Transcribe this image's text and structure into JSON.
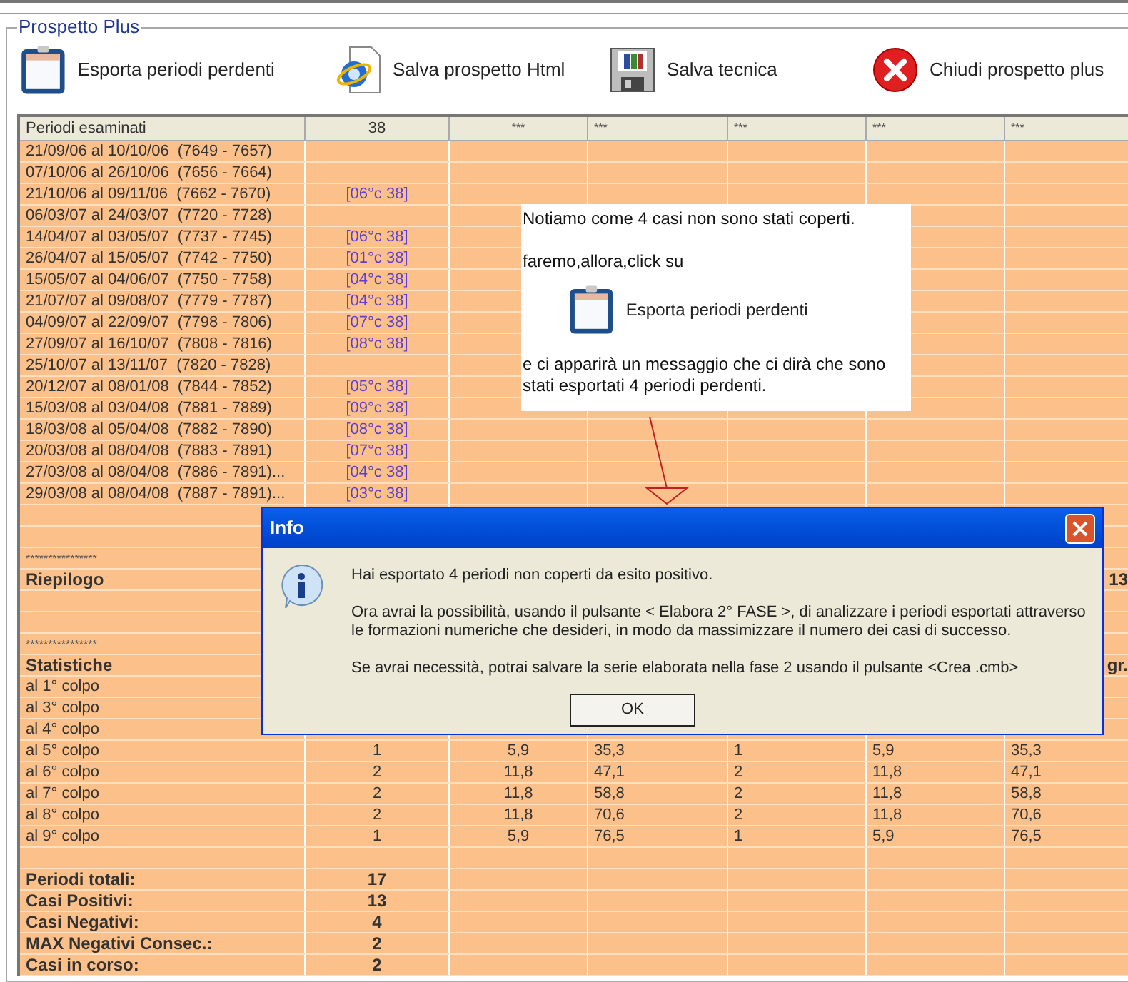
{
  "group_title": "Prospetto Plus",
  "toolbar": [
    {
      "kind": "clipboard",
      "label": "Esporta periodi perdenti"
    },
    {
      "kind": "globe",
      "label": "Salva prospetto Html"
    },
    {
      "kind": "disk",
      "label": "Salva tecnica"
    },
    {
      "kind": "close",
      "label": "Chiudi prospetto plus"
    }
  ],
  "table": {
    "columns": [
      "Periodi esaminati",
      "38",
      "***",
      "***",
      "***",
      "***",
      "***"
    ],
    "rows": [
      {
        "kind": "period",
        "label": "21/09/06 al 10/10/06  (7649 - 7657)"
      },
      {
        "kind": "period",
        "label": "07/10/06 al 26/10/06  (7656 - 7664)"
      },
      {
        "kind": "period",
        "label": "21/10/06 al 09/11/06  (7662 - 7670)",
        "hit": "[06°c 38]"
      },
      {
        "kind": "period",
        "label": "06/03/07 al 24/03/07  (7720 - 7728)"
      },
      {
        "kind": "period",
        "label": "14/04/07 al 03/05/07  (7737 - 7745)",
        "hit": "[06°c 38]"
      },
      {
        "kind": "period",
        "label": "26/04/07 al 15/05/07  (7742 - 7750)",
        "hit": "[01°c 38]"
      },
      {
        "kind": "period",
        "label": "15/05/07 al 04/06/07  (7750 - 7758)",
        "hit": "[04°c 38]"
      },
      {
        "kind": "period",
        "label": "21/07/07 al 09/08/07  (7779 - 7787)",
        "hit": "[04°c 38]"
      },
      {
        "kind": "period",
        "label": "04/09/07 al 22/09/07  (7798 - 7806)",
        "hit": "[07°c 38]"
      },
      {
        "kind": "period",
        "label": "27/09/07 al 16/10/07  (7808 - 7816)",
        "hit": "[08°c 38]"
      },
      {
        "kind": "period",
        "label": "25/10/07 al 13/11/07  (7820 - 7828)"
      },
      {
        "kind": "period",
        "label": "20/12/07 al 08/01/08  (7844 - 7852)",
        "hit": "[05°c 38]"
      },
      {
        "kind": "period",
        "label": "15/03/08 al 03/04/08  (7881 - 7889)",
        "hit": "[09°c 38]"
      },
      {
        "kind": "period",
        "label": "18/03/08 al 05/04/08  (7882 - 7890)",
        "hit": "[08°c 38]"
      },
      {
        "kind": "period",
        "label": "20/03/08 al 08/04/08  (7883 - 7891)",
        "hit": "[07°c 38]"
      },
      {
        "kind": "period",
        "label": "27/03/08 al 08/04/08  (7886 - 7891)...",
        "hit": "[04°c 38]"
      },
      {
        "kind": "period",
        "label": "29/03/08 al 08/04/08  (7887 - 7891)...",
        "hit": "[03°c 38]"
      },
      {
        "kind": "blank"
      },
      {
        "kind": "blank"
      },
      {
        "kind": "separator",
        "label": "****************"
      },
      {
        "kind": "heading",
        "label": "Riepilogo",
        "tail": "13"
      },
      {
        "kind": "blank"
      },
      {
        "kind": "blank"
      },
      {
        "kind": "separator",
        "label": "****************"
      },
      {
        "kind": "heading",
        "label": "Statistiche",
        "tail": "gr."
      },
      {
        "kind": "stat",
        "label": "al 1° colpo"
      },
      {
        "kind": "stat",
        "label": "al 3° colpo"
      },
      {
        "kind": "stat",
        "label": "al 4° colpo"
      },
      {
        "kind": "stat",
        "label": "al 5° colpo",
        "values": [
          "1",
          "5,9",
          "35,3",
          "1",
          "5,9",
          "35,3"
        ]
      },
      {
        "kind": "stat",
        "label": "al 6° colpo",
        "values": [
          "2",
          "11,8",
          "47,1",
          "2",
          "11,8",
          "47,1"
        ]
      },
      {
        "kind": "stat",
        "label": "al 7° colpo",
        "values": [
          "2",
          "11,8",
          "58,8",
          "2",
          "11,8",
          "58,8"
        ]
      },
      {
        "kind": "stat",
        "label": "al 8° colpo",
        "values": [
          "2",
          "11,8",
          "70,6",
          "2",
          "11,8",
          "70,6"
        ]
      },
      {
        "kind": "stat",
        "label": "al 9° colpo",
        "values": [
          "1",
          "5,9",
          "76,5",
          "1",
          "5,9",
          "76,5"
        ]
      },
      {
        "kind": "blank"
      },
      {
        "kind": "total",
        "label": "Periodi totali:",
        "value": "17"
      },
      {
        "kind": "total",
        "label": "Casi Positivi:",
        "value": "13"
      },
      {
        "kind": "total",
        "label": "Casi Negativi:",
        "value": "4"
      },
      {
        "kind": "total",
        "label": "MAX Negativi Consec.:",
        "value": "2"
      },
      {
        "kind": "total",
        "label": "Casi in corso:",
        "value": "2"
      }
    ]
  },
  "callout": {
    "intro": "Notiamo come 4 casi non sono stati coperti.",
    "action": "faremo,allora,click su",
    "button_label": "Esporta periodi perdenti",
    "outcome": "e ci apparirà un messaggio che ci dirà che sono stati esportati 4 periodi perdenti."
  },
  "dialog": {
    "title": "Info",
    "paragraphs": [
      "Hai esportato 4 periodi non coperti da esito positivo.",
      "Ora avrai la possibilità, usando il pulsante < Elabora 2° FASE >, di analizzare i periodi esportati attraverso le formazioni numeriche che desideri, in modo da massimizzare il numero dei casi di successo.",
      "Se avrai necessità, potrai salvare la serie elaborata nella fase 2 usando il pulsante <Crea .cmb>"
    ],
    "ok_label": "OK"
  }
}
